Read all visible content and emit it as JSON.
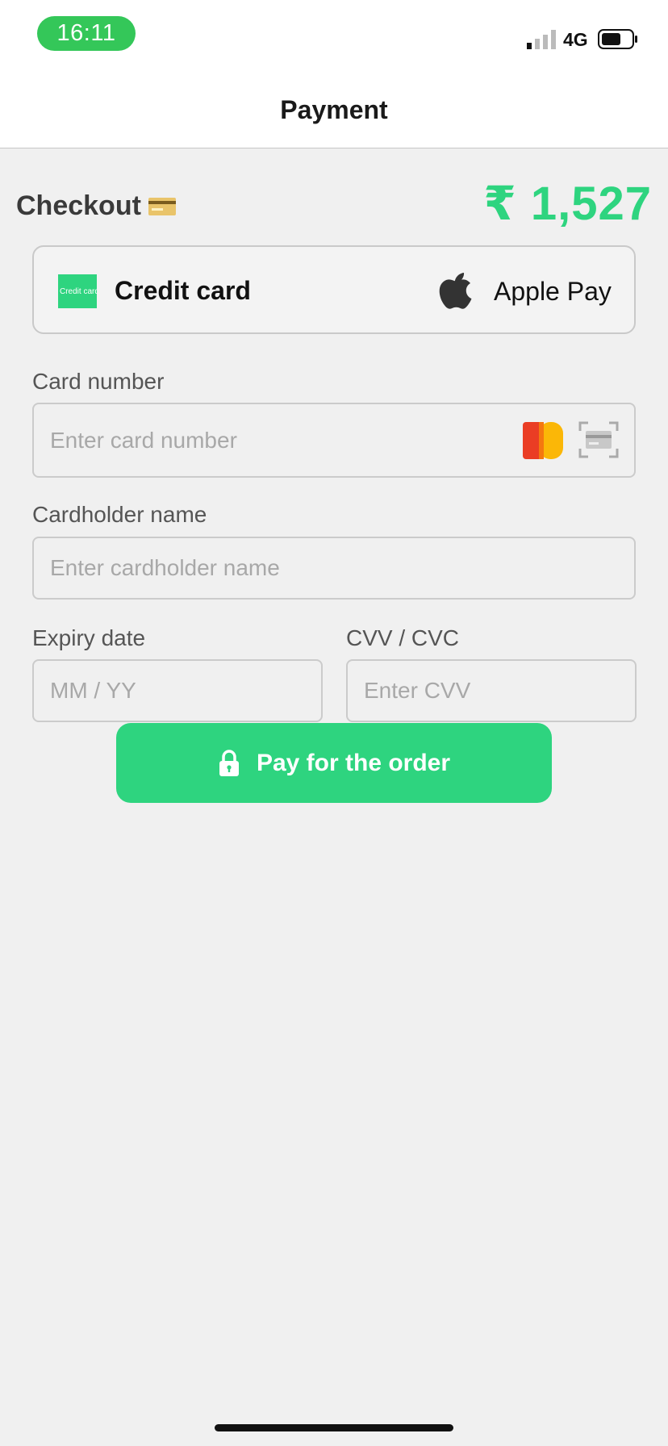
{
  "status_bar": {
    "time": "16:11",
    "network": "4G",
    "icons": [
      "signal-icon",
      "battery-icon"
    ]
  },
  "nav": {
    "title": "Payment"
  },
  "checkout": {
    "label": "Checkout",
    "icon": "credit-card-icon",
    "total": "₹ 1,527"
  },
  "methods": {
    "credit_card": {
      "label": "Credit card",
      "thumb_text": "Credit card"
    },
    "apple_pay": {
      "label": "Apple Pay",
      "icon": "apple-icon"
    }
  },
  "form": {
    "card_number": {
      "label": "Card number",
      "placeholder": "Enter card number",
      "icons": [
        "mastercard-icon",
        "card-scan-icon"
      ]
    },
    "cardholder": {
      "label": "Cardholder name",
      "placeholder": "Enter cardholder name"
    },
    "expiry": {
      "label": "Expiry date",
      "placeholder": "MM / YY"
    },
    "cvv": {
      "label": "CVV / CVC",
      "placeholder": "Enter CVV"
    }
  },
  "pay_button": {
    "label": "Pay for the order",
    "icon": "lock-icon"
  },
  "colors": {
    "accent": "#2ed47f",
    "status_pill": "#34c759",
    "background": "#f0f0f0"
  }
}
